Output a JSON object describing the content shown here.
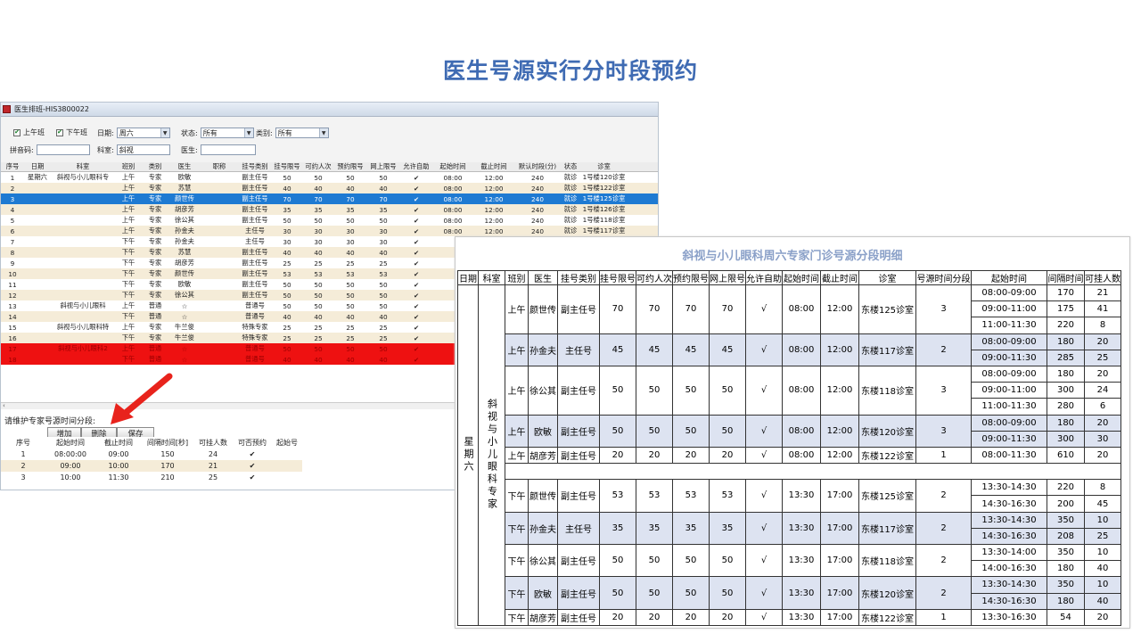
{
  "slide_title": "医生号源实行分时段预约",
  "window": {
    "title": "医生排班-HIS3800022",
    "filters": {
      "am_label": "上午班",
      "pm_label": "下午班",
      "date_label": "日期:",
      "date_value": "周六",
      "status_label": "状态:",
      "status_value": "所有",
      "type_label": "类别:",
      "type_value": "所有",
      "pinyin_label": "拼音码:",
      "pinyin_value": "",
      "dept_label": "科室:",
      "dept_value": "斜视",
      "doctor_label": "医生:",
      "doctor_value": ""
    },
    "columns": [
      "序号",
      "日期",
      "科室",
      "班别",
      "类别",
      "医生",
      "职称",
      "挂号类别",
      "挂号限号",
      "可约人次",
      "预约限号",
      "网上限号",
      "允许自助",
      "起始时间",
      "截止时间",
      "默认时段(分)",
      "状态",
      "诊室"
    ],
    "rows": [
      {
        "no": "1",
        "date": "星期六",
        "dept": "斜视与小儿眼科专",
        "shift": "上午",
        "cat": "专家",
        "doc": "欧敏",
        "title": "",
        "rtype": "副主任号",
        "lim": "50",
        "cap": "50",
        "res": "50",
        "net": "50",
        "auto": "✔",
        "start": "08:00",
        "end": "12:00",
        "dflt": "240",
        "status": "就诊",
        "room": "1号楼120诊室",
        "style": "odd"
      },
      {
        "no": "2",
        "date": "",
        "dept": "",
        "shift": "上午",
        "cat": "专家",
        "doc": "苏慧",
        "title": "",
        "rtype": "副主任号",
        "lim": "40",
        "cap": "40",
        "res": "40",
        "net": "40",
        "auto": "✔",
        "start": "08:00",
        "end": "12:00",
        "dflt": "240",
        "status": "就诊",
        "room": "1号楼122诊室",
        "style": "even"
      },
      {
        "no": "3",
        "date": "",
        "dept": "",
        "shift": "上午",
        "cat": "专家",
        "doc": "颜世传",
        "title": "",
        "rtype": "副主任号",
        "lim": "70",
        "cap": "70",
        "res": "70",
        "net": "70",
        "auto": "✔",
        "start": "08:00",
        "end": "12:00",
        "dflt": "240",
        "status": "就诊",
        "room": "1号楼125诊室",
        "style": "sel"
      },
      {
        "no": "4",
        "date": "",
        "dept": "",
        "shift": "上午",
        "cat": "专家",
        "doc": "胡彦芳",
        "title": "",
        "rtype": "副主任号",
        "lim": "35",
        "cap": "35",
        "res": "35",
        "net": "35",
        "auto": "✔",
        "start": "08:00",
        "end": "12:00",
        "dflt": "240",
        "status": "就诊",
        "room": "1号楼126诊室",
        "style": "even"
      },
      {
        "no": "5",
        "date": "",
        "dept": "",
        "shift": "上午",
        "cat": "专家",
        "doc": "徐公其",
        "title": "",
        "rtype": "副主任号",
        "lim": "50",
        "cap": "50",
        "res": "50",
        "net": "50",
        "auto": "✔",
        "start": "08:00",
        "end": "12:00",
        "dflt": "240",
        "status": "就诊",
        "room": "1号楼118诊室",
        "style": "odd"
      },
      {
        "no": "6",
        "date": "",
        "dept": "",
        "shift": "上午",
        "cat": "专家",
        "doc": "孙金夫",
        "title": "",
        "rtype": "主任号",
        "lim": "30",
        "cap": "30",
        "res": "30",
        "net": "30",
        "auto": "✔",
        "start": "08:00",
        "end": "12:00",
        "dflt": "240",
        "status": "就诊",
        "room": "1号楼117诊室",
        "style": "even"
      },
      {
        "no": "7",
        "date": "",
        "dept": "",
        "shift": "下午",
        "cat": "专家",
        "doc": "孙金夫",
        "title": "",
        "rtype": "主任号",
        "lim": "30",
        "cap": "30",
        "res": "30",
        "net": "30",
        "auto": "✔",
        "start": "",
        "end": "",
        "dflt": "",
        "status": "",
        "room": "",
        "style": "odd"
      },
      {
        "no": "8",
        "date": "",
        "dept": "",
        "shift": "下午",
        "cat": "专家",
        "doc": "苏慧",
        "title": "",
        "rtype": "副主任号",
        "lim": "40",
        "cap": "40",
        "res": "40",
        "net": "40",
        "auto": "✔",
        "start": "",
        "end": "",
        "dflt": "",
        "status": "",
        "room": "",
        "style": "even"
      },
      {
        "no": "9",
        "date": "",
        "dept": "",
        "shift": "下午",
        "cat": "专家",
        "doc": "胡彦芳",
        "title": "",
        "rtype": "副主任号",
        "lim": "25",
        "cap": "25",
        "res": "25",
        "net": "25",
        "auto": "✔",
        "start": "",
        "end": "",
        "dflt": "",
        "status": "",
        "room": "",
        "style": "odd"
      },
      {
        "no": "10",
        "date": "",
        "dept": "",
        "shift": "下午",
        "cat": "专家",
        "doc": "颜世传",
        "title": "",
        "rtype": "副主任号",
        "lim": "53",
        "cap": "53",
        "res": "53",
        "net": "53",
        "auto": "✔",
        "start": "",
        "end": "",
        "dflt": "",
        "status": "",
        "room": "",
        "style": "even"
      },
      {
        "no": "11",
        "date": "",
        "dept": "",
        "shift": "下午",
        "cat": "专家",
        "doc": "欧敏",
        "title": "",
        "rtype": "副主任号",
        "lim": "50",
        "cap": "50",
        "res": "50",
        "net": "50",
        "auto": "✔",
        "start": "",
        "end": "",
        "dflt": "",
        "status": "",
        "room": "",
        "style": "odd"
      },
      {
        "no": "12",
        "date": "",
        "dept": "",
        "shift": "下午",
        "cat": "专家",
        "doc": "徐公其",
        "title": "",
        "rtype": "副主任号",
        "lim": "50",
        "cap": "50",
        "res": "50",
        "net": "50",
        "auto": "✔",
        "start": "",
        "end": "",
        "dflt": "",
        "status": "",
        "room": "",
        "style": "even"
      },
      {
        "no": "13",
        "date": "",
        "dept": "斜视与小儿眼科",
        "shift": "上午",
        "cat": "普通",
        "doc": "☆",
        "title": "",
        "rtype": "普通号",
        "lim": "50",
        "cap": "50",
        "res": "50",
        "net": "50",
        "auto": "✔",
        "start": "",
        "end": "",
        "dflt": "",
        "status": "",
        "room": "",
        "style": "odd"
      },
      {
        "no": "14",
        "date": "",
        "dept": "",
        "shift": "下午",
        "cat": "普通",
        "doc": "☆",
        "title": "",
        "rtype": "普通号",
        "lim": "40",
        "cap": "40",
        "res": "40",
        "net": "40",
        "auto": "✔",
        "start": "",
        "end": "",
        "dflt": "",
        "status": "",
        "room": "",
        "style": "even"
      },
      {
        "no": "15",
        "date": "",
        "dept": "斜视与小儿眼科特",
        "shift": "上午",
        "cat": "专家",
        "doc": "牛兰俊",
        "title": "",
        "rtype": "特殊专家",
        "lim": "25",
        "cap": "25",
        "res": "25",
        "net": "25",
        "auto": "✔",
        "start": "",
        "end": "",
        "dflt": "",
        "status": "",
        "room": "",
        "style": "odd"
      },
      {
        "no": "16",
        "date": "",
        "dept": "",
        "shift": "下午",
        "cat": "专家",
        "doc": "牛兰俊",
        "title": "",
        "rtype": "特殊专家",
        "lim": "25",
        "cap": "25",
        "res": "25",
        "net": "25",
        "auto": "✔",
        "start": "",
        "end": "",
        "dflt": "",
        "status": "",
        "room": "",
        "style": "even"
      },
      {
        "no": "17",
        "date": "",
        "dept": "斜视与小儿眼科2",
        "shift": "上午",
        "cat": "普通",
        "doc": "☆",
        "title": "",
        "rtype": "普通号",
        "lim": "50",
        "cap": "50",
        "res": "50",
        "net": "50",
        "auto": "✔",
        "start": "",
        "end": "",
        "dflt": "",
        "status": "",
        "room": "",
        "style": "red"
      },
      {
        "no": "18",
        "date": "",
        "dept": "",
        "shift": "下午",
        "cat": "普通",
        "doc": "☆",
        "title": "",
        "rtype": "普通号",
        "lim": "40",
        "cap": "40",
        "res": "40",
        "net": "40",
        "auto": "✔",
        "start": "",
        "end": "",
        "dflt": "",
        "status": "",
        "room": "",
        "style": "red"
      }
    ],
    "sub_label": "请维护专家号源时间分段:",
    "buttons": {
      "add": "增加",
      "delete": "删除",
      "save": "保存"
    },
    "sub_columns": [
      "序号",
      "起始时间",
      "截止时间",
      "间隔时间[秒]",
      "可挂人数",
      "可否预约",
      "起始号"
    ],
    "sub_rows": [
      {
        "no": "1",
        "start": "08:00:00",
        "end": "09:00",
        "interval": "150",
        "count": "24",
        "ok": "✔",
        "from": ""
      },
      {
        "no": "2",
        "start": "09:00",
        "end": "10:00",
        "interval": "170",
        "count": "21",
        "ok": "✔",
        "from": ""
      },
      {
        "no": "3",
        "start": "10:00",
        "end": "11:30",
        "interval": "210",
        "count": "25",
        "ok": "✔",
        "from": ""
      }
    ]
  },
  "detail": {
    "title": "斜视与小儿眼科周六专家门诊号源分段明细",
    "headers": [
      "日期",
      "科室",
      "班别",
      "医生",
      "挂号类别",
      "挂号限号",
      "可约人次",
      "预约限号",
      "网上限号",
      "允许自助",
      "起始时间",
      "截止时间",
      "诊室",
      "号源时间分段",
      "起始时间",
      "间隔时间",
      "可挂人数"
    ],
    "day": "星期六",
    "dept": "斜视与小儿眼科专家",
    "groups": [
      {
        "shift": "上午",
        "doc": "颜世传",
        "rtype": "副主任号",
        "lim": "70",
        "cap": "70",
        "res": "70",
        "net": "70",
        "auto": "√",
        "start": "08:00",
        "end": "12:00",
        "room": "东楼125诊室",
        "seg": "3",
        "blue": false,
        "slots": [
          [
            "08:00-09:00",
            "170",
            "21"
          ],
          [
            "09:00-11:00",
            "175",
            "41"
          ],
          [
            "11:00-11:30",
            "220",
            "8"
          ]
        ]
      },
      {
        "shift": "上午",
        "doc": "孙金夫",
        "rtype": "主任号",
        "lim": "45",
        "cap": "45",
        "res": "45",
        "net": "45",
        "auto": "√",
        "start": "08:00",
        "end": "12:00",
        "room": "东楼117诊室",
        "seg": "2",
        "blue": true,
        "slots": [
          [
            "08:00-09:00",
            "180",
            "20"
          ],
          [
            "09:00-11:30",
            "285",
            "25"
          ]
        ]
      },
      {
        "shift": "上午",
        "doc": "徐公其",
        "rtype": "副主任号",
        "lim": "50",
        "cap": "50",
        "res": "50",
        "net": "50",
        "auto": "√",
        "start": "08:00",
        "end": "12:00",
        "room": "东楼118诊室",
        "seg": "3",
        "blue": false,
        "slots": [
          [
            "08:00-09:00",
            "180",
            "20"
          ],
          [
            "09:00-11:00",
            "300",
            "24"
          ],
          [
            "11:00-11:30",
            "280",
            "6"
          ]
        ]
      },
      {
        "shift": "上午",
        "doc": "欧敏",
        "rtype": "副主任号",
        "lim": "50",
        "cap": "50",
        "res": "50",
        "net": "50",
        "auto": "√",
        "start": "08:00",
        "end": "12:00",
        "room": "东楼120诊室",
        "seg": "3",
        "blue": true,
        "slots": [
          [
            "08:00-09:00",
            "180",
            "20"
          ],
          [
            "09:00-11:30",
            "300",
            "30"
          ]
        ]
      },
      {
        "shift": "上午",
        "doc": "胡彦芳",
        "rtype": "副主任号",
        "lim": "20",
        "cap": "20",
        "res": "20",
        "net": "20",
        "auto": "√",
        "start": "08:00",
        "end": "12:00",
        "room": "东楼122诊室",
        "seg": "1",
        "blue": false,
        "slots": [
          [
            "08:00-11:30",
            "610",
            "20"
          ]
        ]
      },
      {
        "spacer": true
      },
      {
        "shift": "下午",
        "doc": "颜世传",
        "rtype": "副主任号",
        "lim": "53",
        "cap": "53",
        "res": "53",
        "net": "53",
        "auto": "√",
        "start": "13:30",
        "end": "17:00",
        "room": "东楼125诊室",
        "seg": "2",
        "blue": false,
        "slots": [
          [
            "13:30-14:30",
            "220",
            "8"
          ],
          [
            "14:30-16:30",
            "200",
            "45"
          ]
        ]
      },
      {
        "shift": "下午",
        "doc": "孙金夫",
        "rtype": "主任号",
        "lim": "35",
        "cap": "35",
        "res": "35",
        "net": "35",
        "auto": "√",
        "start": "13:30",
        "end": "17:00",
        "room": "东楼117诊室",
        "seg": "2",
        "blue": true,
        "slots": [
          [
            "13:30-14:30",
            "350",
            "10"
          ],
          [
            "14:30-16:30",
            "208",
            "25"
          ]
        ]
      },
      {
        "shift": "下午",
        "doc": "徐公其",
        "rtype": "副主任号",
        "lim": "50",
        "cap": "50",
        "res": "50",
        "net": "50",
        "auto": "√",
        "start": "13:30",
        "end": "17:00",
        "room": "东楼118诊室",
        "seg": "2",
        "blue": false,
        "slots": [
          [
            "13:30-14:00",
            "350",
            "10"
          ],
          [
            "14:00-16:30",
            "180",
            "40"
          ]
        ]
      },
      {
        "shift": "下午",
        "doc": "欧敏",
        "rtype": "副主任号",
        "lim": "50",
        "cap": "50",
        "res": "50",
        "net": "50",
        "auto": "√",
        "start": "13:30",
        "end": "17:00",
        "room": "东楼120诊室",
        "seg": "2",
        "blue": true,
        "slots": [
          [
            "13:30-14:30",
            "350",
            "10"
          ],
          [
            "14:30-16:30",
            "180",
            "40"
          ]
        ]
      },
      {
        "shift": "下午",
        "doc": "胡彦芳",
        "rtype": "副主任号",
        "lim": "20",
        "cap": "20",
        "res": "20",
        "net": "20",
        "auto": "√",
        "start": "13:30",
        "end": "17:00",
        "room": "东楼122诊室",
        "seg": "1",
        "blue": false,
        "slots": [
          [
            "13:30-16:30",
            "54",
            "20"
          ]
        ]
      }
    ]
  },
  "colors": {
    "title": "#3f6bb3",
    "selected_row": "#1e7ad2",
    "warning_row": "#ee1111",
    "stripe": "#f5ecd8",
    "blue_band": "#dde3f1",
    "arrow": "#e8231c"
  }
}
